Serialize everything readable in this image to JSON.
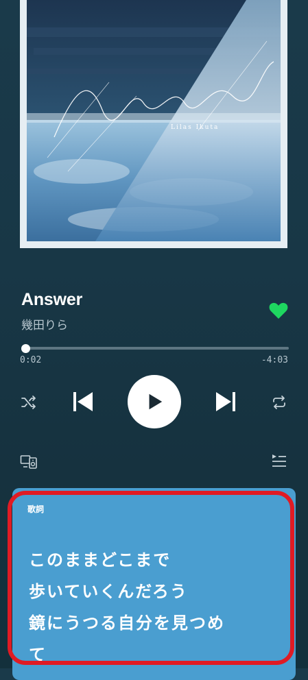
{
  "album_art": {
    "title_script": "Answer",
    "artist_romaji": "Lilas Ikuta"
  },
  "track": {
    "title": "Answer",
    "artist": "幾田りら",
    "liked": true
  },
  "playback": {
    "elapsed": "0:02",
    "remaining": "-4:03",
    "progress": 0.01
  },
  "colors": {
    "accent": "#1ed760",
    "lyrics_bg": "#4a9ed0",
    "highlight": "#e01b24"
  },
  "icons": [
    "shuffle-icon",
    "previous-icon",
    "play-icon",
    "next-icon",
    "repeat-icon",
    "devices-icon",
    "queue-icon",
    "heart-icon"
  ],
  "lyrics": {
    "label": "歌詞",
    "lines": [
      "このままどこまで",
      "歩いていくんだろう",
      "鏡にうつる自分を見つめ",
      "て"
    ]
  }
}
